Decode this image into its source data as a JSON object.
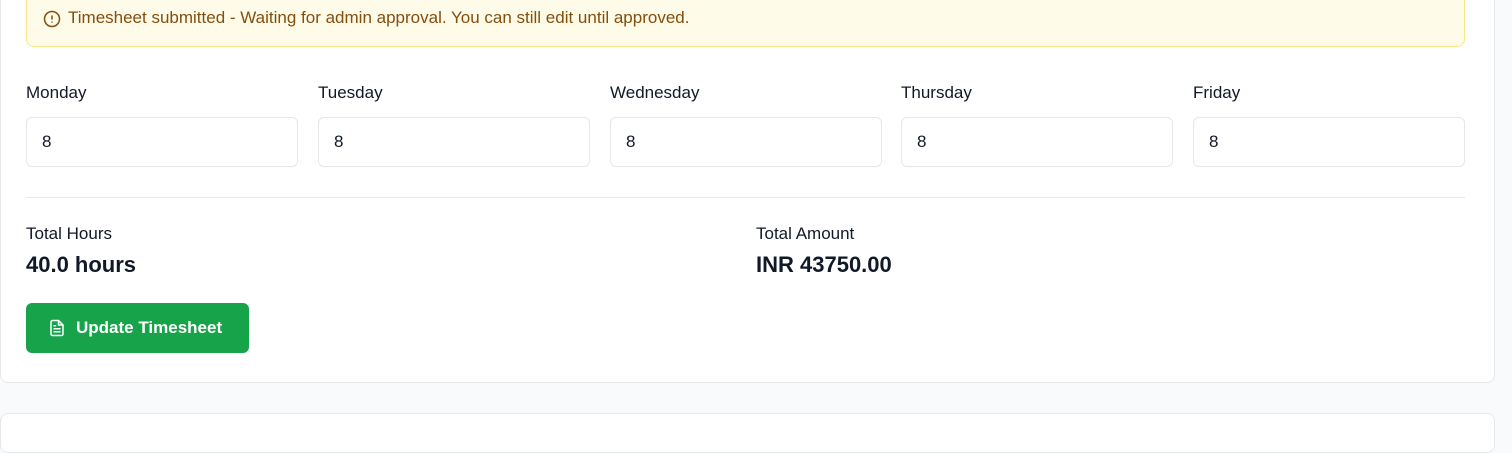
{
  "notice": {
    "icon": "alert-circle-icon",
    "text": "Timesheet submitted - Waiting for admin approval. You can still edit until approved.",
    "bg_color": "#fefce8",
    "text_color": "#854d0e"
  },
  "days": [
    {
      "label": "Monday",
      "value": "8"
    },
    {
      "label": "Tuesday",
      "value": "8"
    },
    {
      "label": "Wednesday",
      "value": "8"
    },
    {
      "label": "Thursday",
      "value": "8"
    },
    {
      "label": "Friday",
      "value": "8"
    }
  ],
  "summary": {
    "total_hours_label": "Total Hours",
    "total_hours_value": "40.0 hours",
    "total_amount_label": "Total Amount",
    "total_amount_value": "INR 43750.00"
  },
  "actions": {
    "update_label": "Update Timesheet",
    "update_icon": "file-text-icon",
    "update_color": "#16a34a"
  }
}
